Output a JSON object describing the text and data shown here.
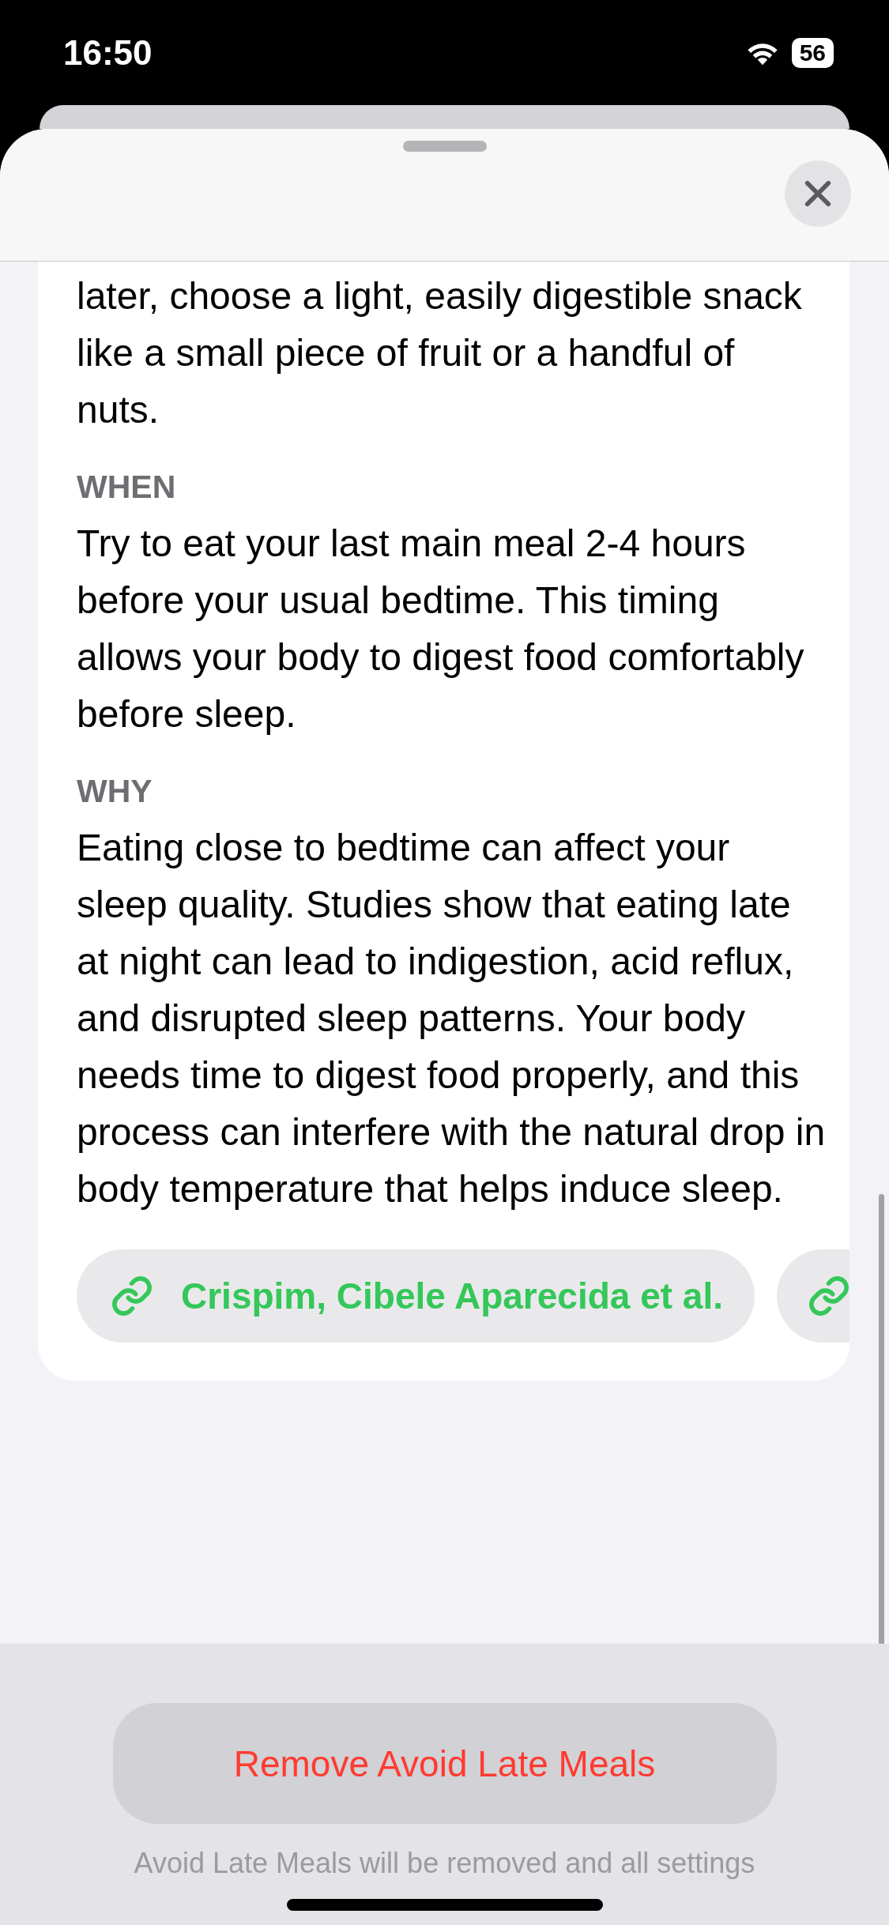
{
  "status_bar": {
    "time": "16:50",
    "battery": "56"
  },
  "intro": "later, choose a light, easily digestible snack like a small piece of fruit or a handful of nuts.",
  "sections": [
    {
      "heading": "WHEN",
      "body": "Try to eat your last main meal 2-4 hours before your usual bedtime. This timing allows your body to digest food comfortably before sleep."
    },
    {
      "heading": "WHY",
      "body": "Eating close to bedtime can affect your sleep quality. Studies show that eating late at night can lead to indigestion, acid reflux, and disrupted sleep patterns. Your body needs time to digest food properly, and this process can interfere with the natural drop in body temperature that helps induce sleep."
    }
  ],
  "sources": [
    {
      "label": "Crispim, Cibele Aparecida et al."
    }
  ],
  "remove_button": "Remove Avoid Late Meals",
  "footnote": "Avoid Late Meals will be removed and all settings"
}
